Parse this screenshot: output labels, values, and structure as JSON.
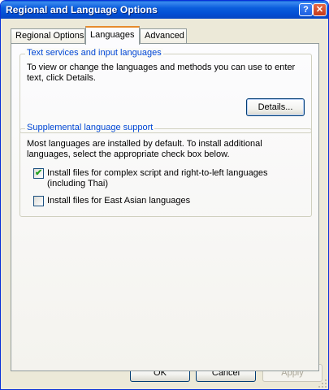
{
  "window": {
    "title": "Regional and Language Options"
  },
  "tabs": [
    {
      "label": "Regional Options",
      "active": false
    },
    {
      "label": "Languages",
      "active": true
    },
    {
      "label": "Advanced",
      "active": false
    }
  ],
  "text_services": {
    "title": "Text services and input languages",
    "description": "To view or change the languages and methods you can use to enter text, click Details.",
    "details_label": "Details..."
  },
  "supplemental": {
    "title": "Supplemental language support",
    "description": "Most languages are installed by default. To install additional languages, select the appropriate check box below.",
    "complex_script_label": "Install files for complex script and right-to-left languages (including Thai)",
    "complex_script_checked": true,
    "east_asian_label": "Install files for East Asian languages",
    "east_asian_checked": false
  },
  "footer": {
    "ok_label": "OK",
    "cancel_label": "Cancel",
    "apply_label": "Apply"
  }
}
